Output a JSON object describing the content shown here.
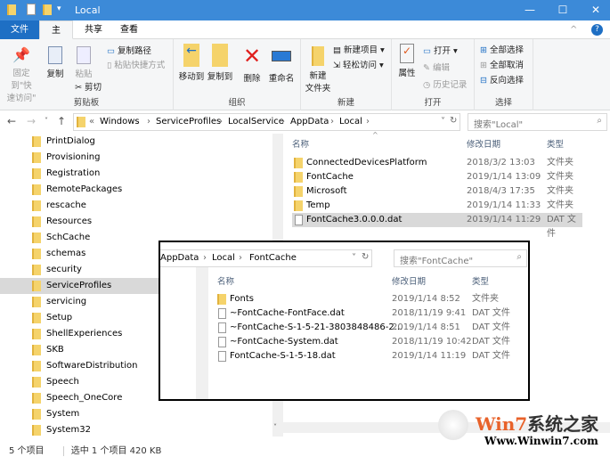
{
  "window": {
    "title": "Local",
    "minimize": "—",
    "maximize": "☐",
    "close": "✕"
  },
  "tabs": [
    "文件",
    "主页",
    "共享",
    "查看"
  ],
  "ribbon": {
    "clipboard": {
      "label": "剪贴板",
      "pin": "固定到\"快\n速访问\"",
      "copy": "复制",
      "paste": "粘贴",
      "copy_path": "复制路径",
      "paste_shortcut": "粘贴快捷方式",
      "cut": "剪切"
    },
    "organize": {
      "label": "组织",
      "move_to": "移动到",
      "copy_to": "复制到",
      "delete": "删除",
      "rename": "重命名"
    },
    "new": {
      "label": "新建",
      "new_folder": "新建\n文件夹",
      "new_item": "新建项目 ▾",
      "easy_access": "轻松访问 ▾"
    },
    "open": {
      "label": "打开",
      "properties": "属性",
      "open": "打开 ▾",
      "edit": "编辑",
      "history": "历史记录"
    },
    "select": {
      "label": "选择",
      "select_all": "全部选择",
      "select_none": "全部取消",
      "invert": "反向选择"
    }
  },
  "address": {
    "crumbs": [
      "«",
      "Windows",
      "›",
      "ServiceProfiles",
      "›",
      "LocalService",
      "›",
      "AppData",
      "›",
      "Local",
      "›"
    ],
    "search_placeholder": "搜索\"Local\""
  },
  "nav_items": [
    "PrintDialog",
    "Provisioning",
    "Registration",
    "RemotePackages",
    "rescache",
    "Resources",
    "SchCache",
    "schemas",
    "security",
    "ServiceProfiles",
    "servicing",
    "Setup",
    "ShellExperiences",
    "SKB",
    "SoftwareDistribution",
    "Speech",
    "Speech_OneCore",
    "System",
    "System32"
  ],
  "columns": {
    "name": "名称",
    "date": "修改日期",
    "type": "类型"
  },
  "files": [
    {
      "name": "ConnectedDevicesPlatform",
      "date": "2018/3/2 13:03",
      "type": "文件夹",
      "folder": true
    },
    {
      "name": "FontCache",
      "date": "2019/1/14 13:09",
      "type": "文件夹",
      "folder": true
    },
    {
      "name": "Microsoft",
      "date": "2018/4/3 17:35",
      "type": "文件夹",
      "folder": true
    },
    {
      "name": "Temp",
      "date": "2019/1/14 11:33",
      "type": "文件夹",
      "folder": true
    },
    {
      "name": "FontCache3.0.0.0.dat",
      "date": "2019/1/14 11:29",
      "type": "DAT 文件",
      "folder": false,
      "selected": true
    }
  ],
  "overlay": {
    "crumbs": [
      "AppData",
      "›",
      "Local",
      "›",
      "FontCache"
    ],
    "search_placeholder": "搜索\"FontCache\"",
    "files": [
      {
        "name": "Fonts",
        "date": "2019/1/14 8:52",
        "type": "文件夹",
        "folder": true
      },
      {
        "name": "~FontCache-FontFace.dat",
        "date": "2018/11/19 9:41",
        "type": "DAT 文件",
        "folder": false
      },
      {
        "name": "~FontCache-S-1-5-21-3803848486-2...",
        "date": "2019/1/14 8:51",
        "type": "DAT 文件",
        "folder": false
      },
      {
        "name": "~FontCache-System.dat",
        "date": "2018/11/19 10:42",
        "type": "DAT 文件",
        "folder": false
      },
      {
        "name": "FontCache-S-1-5-18.dat",
        "date": "2019/1/14 11:19",
        "type": "DAT 文件",
        "folder": false
      }
    ]
  },
  "status": {
    "count": "5 个项目",
    "selected": "选中 1 个项目  420 KB"
  },
  "watermark": {
    "brand": "Win7系统之家",
    "url": "Www.Winwin7.com"
  }
}
